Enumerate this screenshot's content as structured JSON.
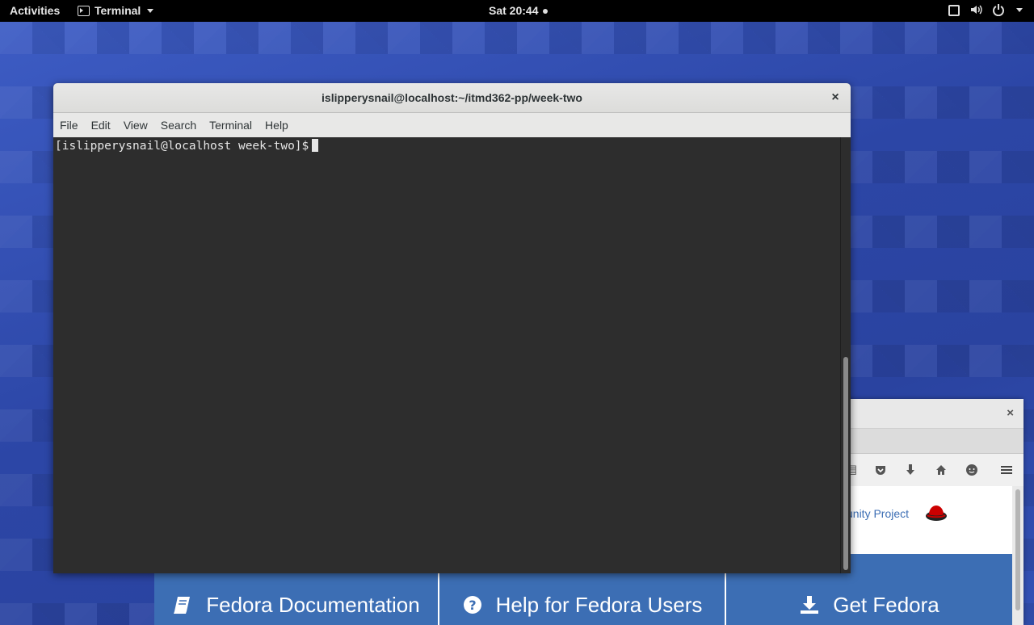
{
  "topbar": {
    "activities": "Activities",
    "app_menu": "Terminal",
    "clock": "Sat 20:44"
  },
  "terminal": {
    "title": "islipperysnail@localhost:~/itmd362-pp/week-two",
    "menu": [
      "File",
      "Edit",
      "View",
      "Search",
      "Terminal",
      "Help"
    ],
    "prompt": "[islipperysnail@localhost week-two]$"
  },
  "firefox": {
    "link_text": "unity Project"
  },
  "fedora_links": [
    {
      "label": "Fedora Documentation",
      "icon": "book-icon"
    },
    {
      "label": "Help for Fedora Users",
      "icon": "question-icon"
    },
    {
      "label": "Get Fedora",
      "icon": "download-icon"
    }
  ],
  "colors": {
    "topbar": "#000000",
    "terminal_bg": "#2d2d2d",
    "fedora_blue": "#3c6eb4",
    "desktop_blue": "#2f4aa8"
  }
}
